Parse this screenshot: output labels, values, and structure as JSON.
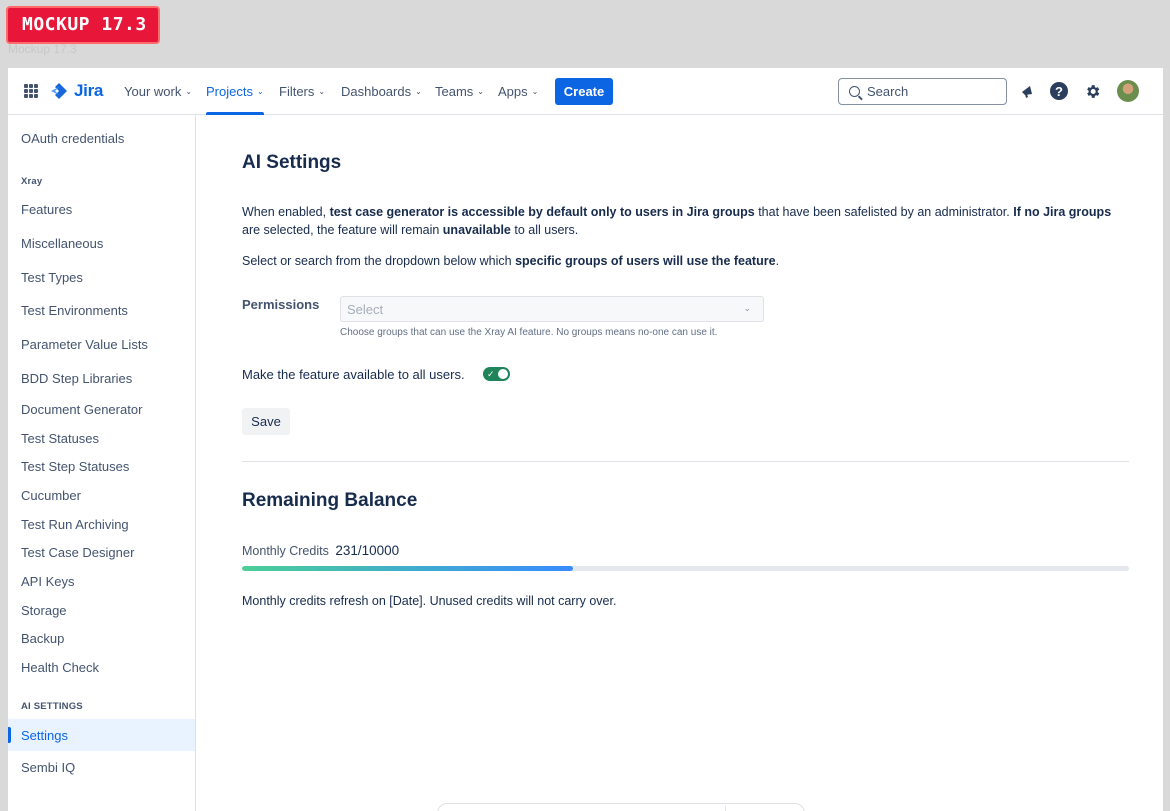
{
  "badge": {
    "label": "MOCKUP 17.3",
    "ghost": "Mockup 17.3"
  },
  "nav": {
    "logo": "Jira",
    "items": [
      {
        "label": "Your work",
        "chevron": "⌄"
      },
      {
        "label": "Projects",
        "chevron": "⌄"
      },
      {
        "label": "Filters",
        "chevron": "⌄"
      },
      {
        "label": "Dashboards",
        "chevron": "⌄"
      },
      {
        "label": "Teams",
        "chevron": "⌄"
      },
      {
        "label": "Apps",
        "chevron": "⌄"
      }
    ],
    "create": "Create",
    "search_placeholder": "Search",
    "help_glyph": "?"
  },
  "sidebar": {
    "top_item": "OAuth credentials",
    "xray_heading": "Xray",
    "xray_items": [
      "Features",
      "Miscellaneous",
      "Test Types",
      "Test Environments",
      "Parameter Value Lists",
      "BDD Step Libraries",
      "Document Generator",
      "Test Statuses",
      "Test Step Statuses",
      "Cucumber",
      "Test Run Archiving",
      "Test Case Designer",
      "API Keys",
      "Storage",
      "Backup",
      "Health Check"
    ],
    "ai_heading": "AI SETTINGS",
    "ai_items": [
      "Settings",
      "Sembi IQ"
    ]
  },
  "main": {
    "title": "AI Settings",
    "intro": {
      "t1": "When enabled, ",
      "b1": "test case generator is accessible by default only to users in Jira groups",
      "t2": " that have been safelisted by an administrator. ",
      "b2": "If no Jira groups",
      "t3": " are selected, the feature will remain ",
      "b3": "unavailable",
      "t4": " to all users."
    },
    "select_note": {
      "t1": "Select or search from the dropdown below which ",
      "b1": "specific groups of users will use the feature",
      "t2": "."
    },
    "permissions_label": "Permissions",
    "select_placeholder": "Select",
    "select_chevron": "⌄",
    "helper": "Choose groups that can use the Xray AI feature. No groups means no-one can use it.",
    "toggle_label": "Make the feature available to all users.",
    "toggle_on": true,
    "toggle_check": "✓",
    "save": "Save",
    "balance_title": "Remaining Balance",
    "credits_label": "Monthly Credits",
    "credits_value": "231/10000",
    "credits_used": 231,
    "credits_total": 10000,
    "refresh_note": "Monthly credits refresh on [Date]. Unused credits will not carry over."
  },
  "colors": {
    "accent": "#0c66e4",
    "badge": "#e8173a",
    "toggle_on": "#1f845a",
    "progress_start": "#4bce97",
    "progress_end": "#388bff"
  }
}
